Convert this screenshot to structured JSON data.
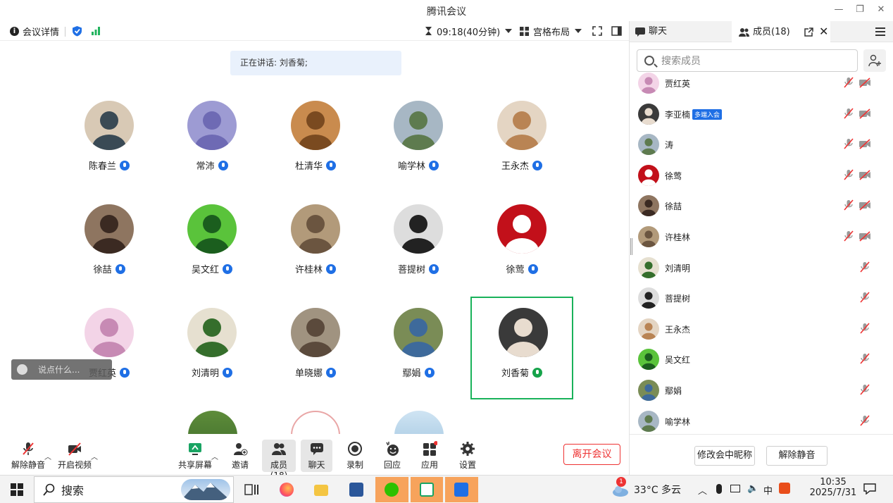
{
  "window": {
    "title": "腾讯会议"
  },
  "toolbar": {
    "meeting_info": "会议详情",
    "timer": "09:18(40分钟)",
    "layout": "宫格布局"
  },
  "speaking": {
    "label": "正在讲话: 刘香菊;"
  },
  "grid": [
    {
      "name": "陈春兰"
    },
    {
      "name": "常沛"
    },
    {
      "name": "杜清华"
    },
    {
      "name": "喻学林"
    },
    {
      "name": "王永杰"
    },
    {
      "name": "徐喆"
    },
    {
      "name": "吴文红"
    },
    {
      "name": "许桂林"
    },
    {
      "name": "菩提树"
    },
    {
      "name": "徐莺"
    },
    {
      "name": "贾红英"
    },
    {
      "name": "刘清明"
    },
    {
      "name": "单晓娜"
    },
    {
      "name": "鄢娟"
    },
    {
      "name": "刘香菊"
    }
  ],
  "chat_input": {
    "placeholder": "说点什么..."
  },
  "bottombar": {
    "unmute": "解除静音",
    "start_video": "开启视频",
    "share": "共享屏幕",
    "invite": "邀请",
    "members": "成员(18)",
    "chat": "聊天",
    "record": "录制",
    "react": "回应",
    "apps": "应用",
    "settings": "设置",
    "leave": "离开会议"
  },
  "panel": {
    "tab_chat": "聊天",
    "tab_members": "成员(18)",
    "search_placeholder": "搜索成员",
    "multi_join_badge": "多端入会",
    "members": [
      {
        "name": "贾红英"
      },
      {
        "name": "李亚楠"
      },
      {
        "name": "涛"
      },
      {
        "name": "徐莺"
      },
      {
        "name": "徐喆"
      },
      {
        "name": "许桂林"
      },
      {
        "name": "刘清明"
      },
      {
        "name": "菩提树"
      },
      {
        "name": "王永杰"
      },
      {
        "name": "吴文红"
      },
      {
        "name": "鄢娟"
      },
      {
        "name": "喻学林"
      }
    ],
    "rename_button": "修改会中昵称",
    "unmute_button": "解除静音"
  },
  "taskbar": {
    "search": "搜索",
    "weather": "33°C 多云",
    "notification_count": "1",
    "time": "10:35",
    "date": "2025/7/31"
  }
}
